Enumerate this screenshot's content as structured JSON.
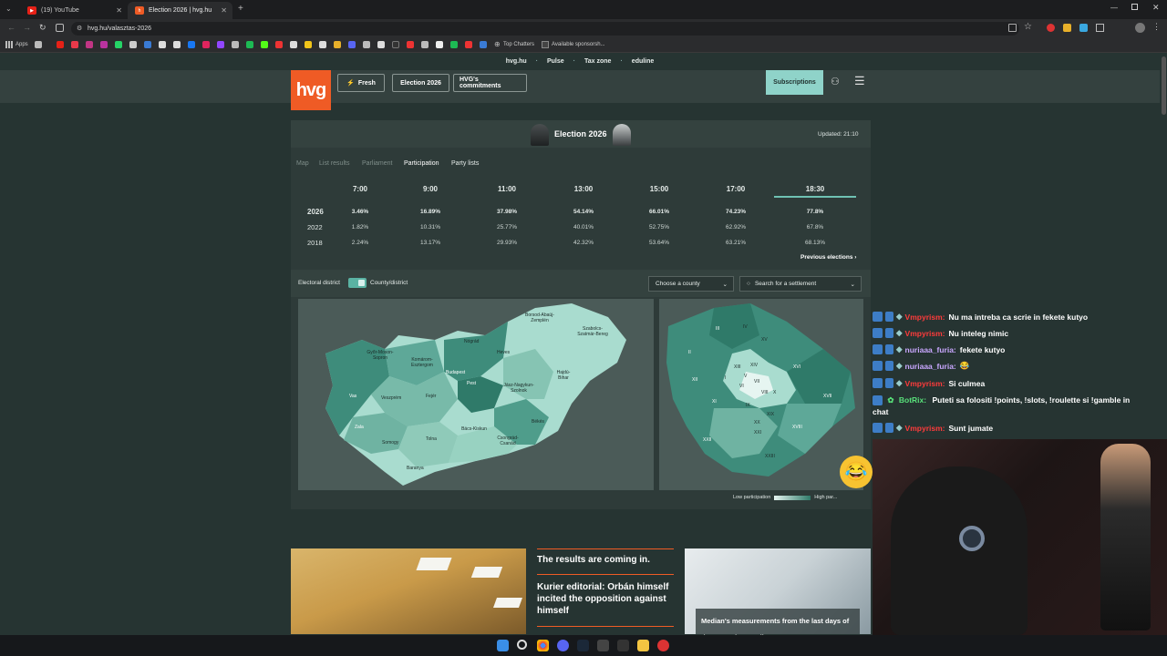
{
  "browser": {
    "tabs": [
      {
        "title": "(19) YouTube",
        "active": false
      },
      {
        "title": "Election 2026 | hvg.hu",
        "active": true
      }
    ],
    "url": "hvg.hu/valasztas-2026",
    "bookmarks": {
      "apps": "Apps",
      "top_chatters": "Top Chatters",
      "available": "Available sponsorsh..."
    }
  },
  "site": {
    "topnav": [
      "hvg.hu",
      "Pulse",
      "Tax zone",
      "eduline"
    ],
    "logo": "hvg",
    "header_buttons": {
      "fresh": "Fresh",
      "election": "Election 2026",
      "commitments": "HVG's commitments"
    },
    "subscriptions": "Subscriptions",
    "accent": "#ef5b25",
    "teal": "#8fd3c9"
  },
  "panel": {
    "title": "Election 2026",
    "updated": "Updated: 21:10",
    "tabs": [
      "Map",
      "List results",
      "Parliament",
      "Participation",
      "Party lists"
    ],
    "active_tab": "Participation",
    "times": [
      "7:00",
      "9:00",
      "11:00",
      "13:00",
      "15:00",
      "17:00",
      "18:30"
    ],
    "rows": [
      {
        "year": "2026",
        "values": [
          "3.46%",
          "16.89%",
          "37.98%",
          "54.14%",
          "66.01%",
          "74.23%",
          "77.8%"
        ]
      },
      {
        "year": "2022",
        "values": [
          "1.82%",
          "10.31%",
          "25.77%",
          "40.01%",
          "52.75%",
          "62.92%",
          "67.8%"
        ]
      },
      {
        "year": "2018",
        "values": [
          "2.24%",
          "13.17%",
          "29.93%",
          "42.32%",
          "53.64%",
          "63.21%",
          "68.13%"
        ]
      }
    ],
    "previous": "Previous elections",
    "map_toggle": {
      "left": "Electoral district",
      "right": "County/district"
    },
    "county_select": "Choose a county",
    "settlement_search": "Search for a settlement",
    "legend": {
      "low": "Low participation",
      "high": "High par..."
    },
    "counties": [
      "Győr-Moson-Sopron",
      "Komárom-Esztergom",
      "Nógrád",
      "Borsod-Abaúj-Zemplén",
      "Szabolcs-Szatmár-Bereg",
      "Heves",
      "Budapest",
      "Pest",
      "Vas",
      "Veszprém",
      "Fejér",
      "Hajdú-Bihar",
      "Jász-Nagykun-Szolnok",
      "Zala",
      "Somogy",
      "Tolna",
      "Bács-Kiskun",
      "Csongrád-Csanád",
      "Békés",
      "Baranya"
    ],
    "districts": [
      "II",
      "III",
      "IV",
      "XV",
      "XVI",
      "I",
      "XII",
      "XIII",
      "V",
      "VI",
      "VII",
      "VIII",
      "XIV",
      "X",
      "XVII",
      "XI",
      "IX",
      "XIX",
      "XVIII",
      "XX",
      "XXI",
      "XXII",
      "XXIII"
    ]
  },
  "articles": {
    "headline1": "The results are coming in.",
    "headline2": "Kurier editorial: Orbán himself incited the opposition against himself",
    "overlay": "Median's measurements from the last days of the campaign predict"
  },
  "chat": [
    {
      "user": "Vmpyrism:",
      "msg": "Nu ma intreba ca scrie in fekete kutyo",
      "color": "#ff3b3b"
    },
    {
      "user": "Vmpyrism:",
      "msg": "Nu inteleg nimic",
      "color": "#ff3b3b"
    },
    {
      "user": "nuriaaa_furia:",
      "msg": "fekete kutyo",
      "color": "#c9a7ff"
    },
    {
      "user": "nuriaaa_furia:",
      "msg": "😂",
      "color": "#c9a7ff"
    },
    {
      "user": "Vmpyrism:",
      "msg": "Si culmea",
      "color": "#ff3b3b"
    },
    {
      "user": "BotRix:",
      "msg": "Puteti sa folositi !points, !slots, !roulette si !gamble in chat",
      "color": "#58e07a"
    },
    {
      "user": "Vmpyrism:",
      "msg": "Sunt jumate",
      "color": "#ff3b3b"
    }
  ]
}
